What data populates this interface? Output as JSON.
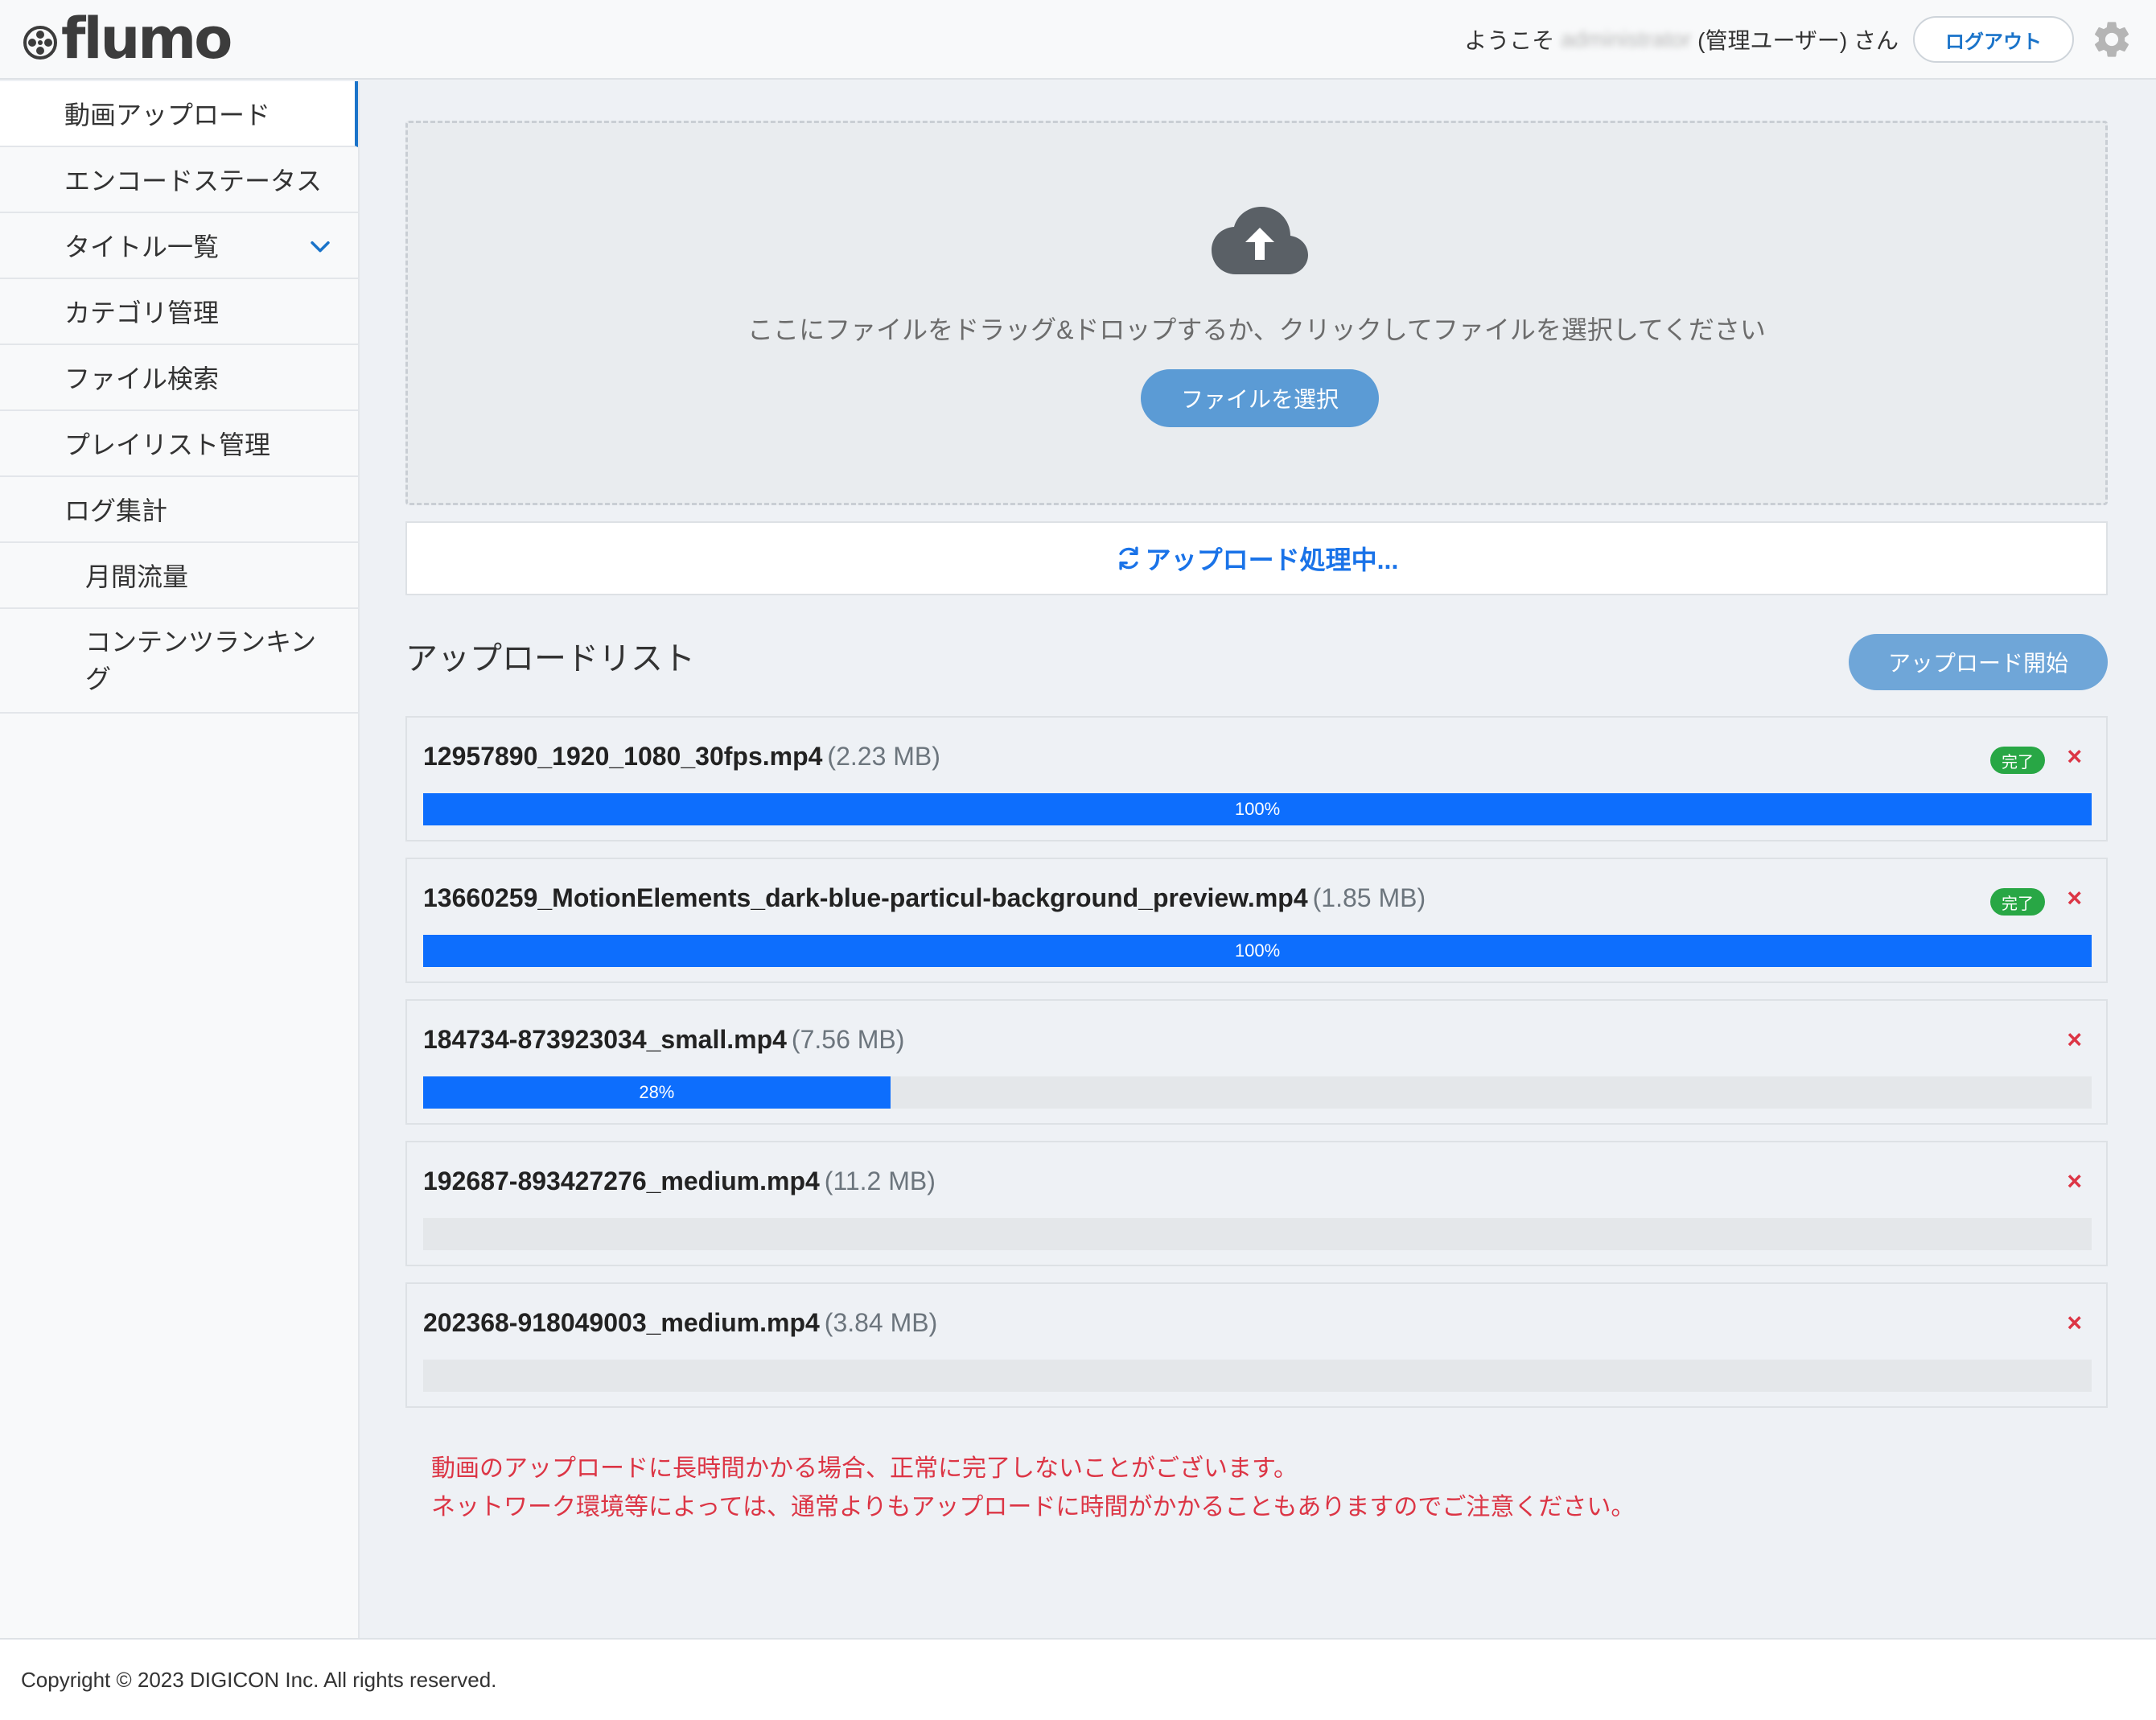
{
  "header": {
    "logo_text": "flumo",
    "welcome_prefix": "ようこそ",
    "username": "administrator",
    "welcome_suffix": "(管理ユーザー) さん",
    "logout_label": "ログアウト",
    "settings_icon": "gear-icon"
  },
  "sidebar": {
    "items": [
      {
        "label": "動画アップロード"
      },
      {
        "label": "エンコードステータス"
      },
      {
        "label": "タイトル一覧"
      },
      {
        "label": "カテゴリ管理"
      },
      {
        "label": "ファイル検索"
      },
      {
        "label": "プレイリスト管理"
      },
      {
        "label": "ログ集計"
      },
      {
        "label": "月間流量"
      },
      {
        "label": "コンテンツランキング"
      }
    ]
  },
  "dropzone": {
    "instruction": "ここにファイルをドラッグ&ドロップするか、クリックしてファイルを選択してください",
    "select_button": "ファイルを選択"
  },
  "processing_text": "アップロード処理中...",
  "upload_list": {
    "title": "アップロードリスト",
    "start_button": "アップロード開始",
    "files": [
      {
        "name": "12957890_1920_1080_30fps.mp4",
        "size": "(2.23 MB)",
        "progress": 100,
        "progress_label": "100%",
        "status": "完了"
      },
      {
        "name": "13660259_MotionElements_dark-blue-particul-background_preview.mp4",
        "size": "(1.85 MB)",
        "progress": 100,
        "progress_label": "100%",
        "status": "完了"
      },
      {
        "name": "184734-873923034_small.mp4",
        "size": "(7.56 MB)",
        "progress": 28,
        "progress_label": "28%",
        "status": ""
      },
      {
        "name": "192687-893427276_medium.mp4",
        "size": "(11.2 MB)",
        "progress": 0,
        "progress_label": "",
        "status": ""
      },
      {
        "name": "202368-918049003_medium.mp4",
        "size": "(3.84 MB)",
        "progress": 0,
        "progress_label": "",
        "status": ""
      }
    ],
    "remove_symbol": "×"
  },
  "warning": {
    "line1": "動画のアップロードに長時間かかる場合、正常に完了しないことがございます。",
    "line2": "ネットワーク環境等によっては、通常よりもアップロードに時間がかかることもありますのでご注意ください。"
  },
  "footer": {
    "copyright": "Copyright © 2023 DIGICON Inc. All rights reserved."
  },
  "colors": {
    "accent": "#1a73c9",
    "progress": "#0d6efd",
    "success": "#28a745",
    "danger": "#dc3545"
  }
}
